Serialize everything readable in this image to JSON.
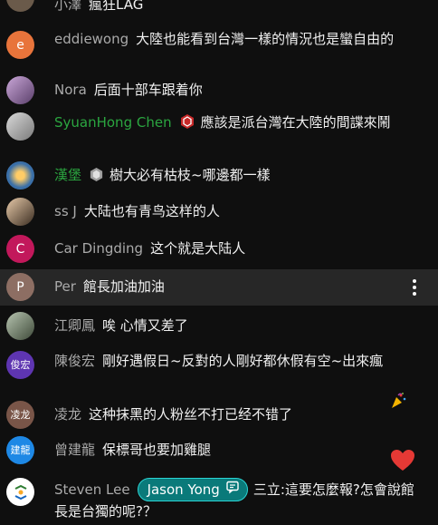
{
  "messages": [
    {
      "author": "小澤",
      "text": "瘋狂LAG",
      "avatar_letter": "",
      "avatar_color": "#6a5a4a"
    },
    {
      "author": "eddiewong",
      "text": "大陸也能看到台灣一樣的情況也是蠻自由的",
      "avatar_letter": "e",
      "avatar_color": "#e8743b"
    },
    {
      "author": "Nora",
      "text": "后面十部车跟着你",
      "avatar_letter": "",
      "avatar_color": "#8a6f9a"
    },
    {
      "author": "SyuanHong Chen",
      "text": "應該是派台灣在大陸的間諜來鬧",
      "avatar_letter": "",
      "avatar_color": "#9a9a9a"
    },
    {
      "author": "漢堡",
      "text": "樹大必有枯枝~哪邊都一樣",
      "avatar_letter": "",
      "avatar_color": "#3a6fa8"
    },
    {
      "author": "ss J",
      "text": "大陆也有青鸟这样的人",
      "avatar_letter": "",
      "avatar_color": "#5a4a3a"
    },
    {
      "author": "Car Dingding",
      "text": "这个就是大陆人",
      "avatar_letter": "C",
      "avatar_color": "#c2185b"
    },
    {
      "author": "Per",
      "text": "館長加油加油",
      "avatar_letter": "P",
      "avatar_color": "#8d6e63"
    },
    {
      "author": "江卿鳳",
      "text": "唉 心情又差了",
      "avatar_letter": "",
      "avatar_color": "#6b7b6b"
    },
    {
      "author": "陳俊宏",
      "text": "剛好遇假日~反對的人剛好都休假有空~出來瘋",
      "avatar_letter": "俊宏",
      "avatar_color": "#5e35b1"
    },
    {
      "author": "凌龙",
      "text": "这种抹黑的人粉丝不打已经不错了",
      "avatar_letter": "凌龙",
      "avatar_color": "#795548"
    },
    {
      "author": "曾建龍",
      "text": "保標哥也要加雞腿",
      "avatar_letter": "建龍",
      "avatar_color": "#1e88e5"
    },
    {
      "author": "Steven Lee",
      "mention": "Jason Yong",
      "text": "三立:這要怎麼報?怎會說館長是台獨的呢?？",
      "avatar_letter": "",
      "avatar_color": "#ffffff"
    }
  ],
  "icons": {
    "more": "more-vert-icon",
    "member_badge": "member-badge-icon",
    "moderator_badge": "moderator-badge-icon",
    "heart": "heart-icon",
    "party": "party-popper-icon",
    "mention": "comment-icon"
  },
  "colors": {
    "background": "#0f0f0f",
    "highlight": "#272727",
    "author": "#aaaaaa",
    "moderator": "#2ba640",
    "member_badge": "#e53935",
    "mention_bg": "#0a7a7a",
    "heart": "#e53935"
  }
}
